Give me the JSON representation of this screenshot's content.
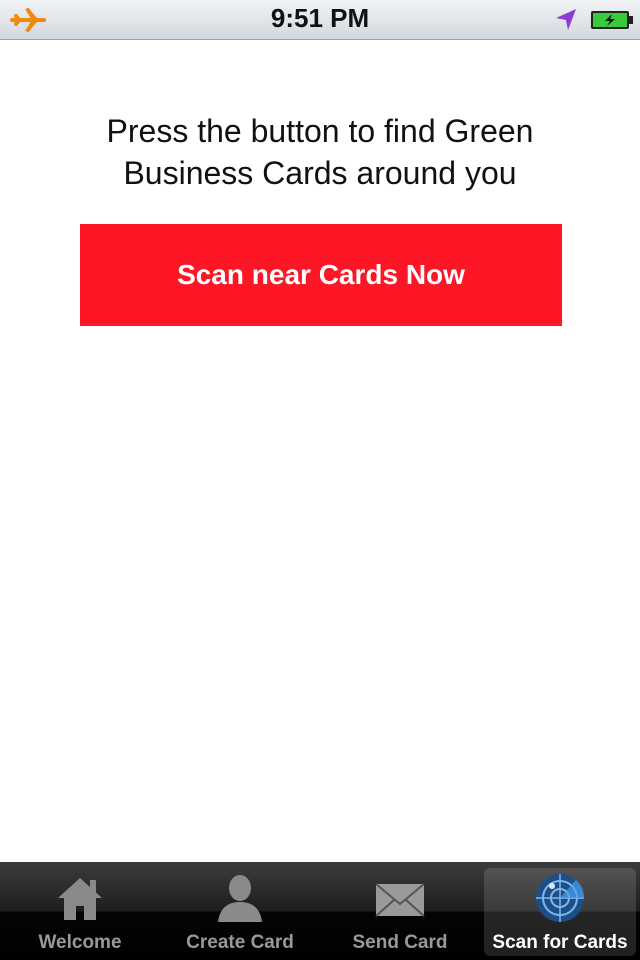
{
  "status_bar": {
    "time": "9:51 PM",
    "icons": [
      "airplane-icon",
      "location-icon",
      "battery-icon"
    ]
  },
  "main": {
    "message": "Press the button to find Green\nBusiness Cards around you",
    "scan_button_label": "Scan near Cards Now",
    "scan_button_color": "#fd1625"
  },
  "tab_bar": {
    "tabs": [
      {
        "label": "Welcome",
        "icon": "home-icon",
        "active": false
      },
      {
        "label": "Create Card",
        "icon": "person-icon",
        "active": false
      },
      {
        "label": "Send Card",
        "icon": "envelope-icon",
        "active": false
      },
      {
        "label": "Scan for Cards",
        "icon": "radar-icon",
        "active": true
      }
    ]
  }
}
